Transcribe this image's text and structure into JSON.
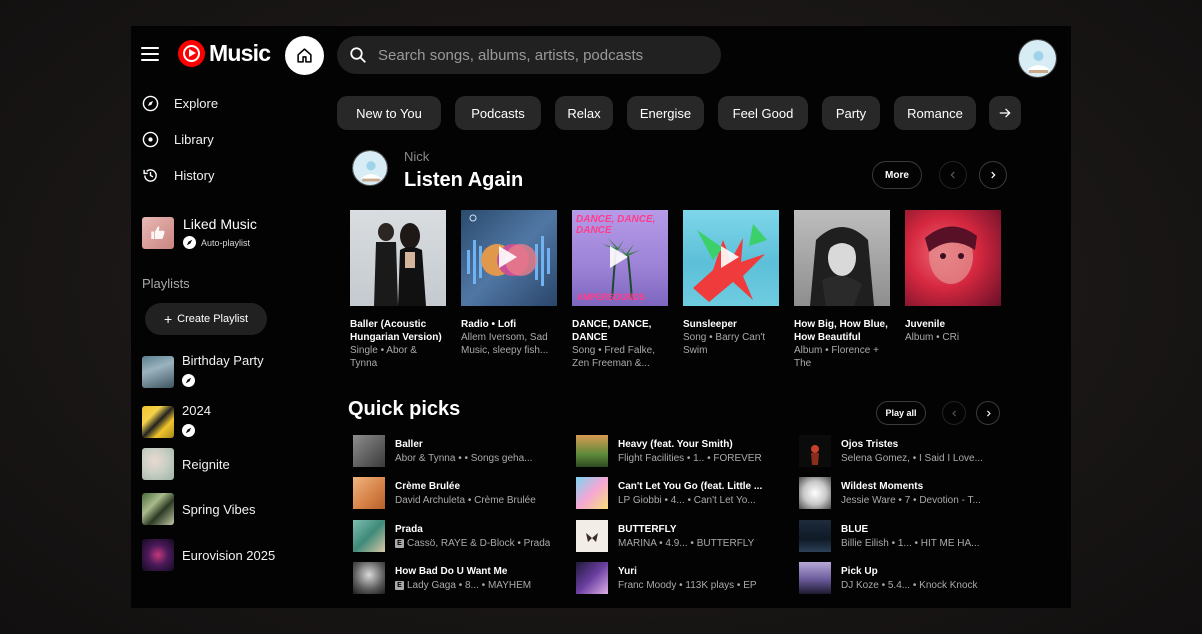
{
  "app": {
    "logo_text": "Music"
  },
  "search": {
    "placeholder": "Search songs, albums, artists, podcasts"
  },
  "nav": [
    {
      "label": "Explore",
      "icon": "compass-icon"
    },
    {
      "label": "Library",
      "icon": "library-icon"
    },
    {
      "label": "History",
      "icon": "history-icon"
    }
  ],
  "liked": {
    "title": "Liked Music",
    "subtitle": "Auto-playlist"
  },
  "playlists": {
    "heading": "Playlists",
    "create_label": "Create Playlist",
    "items": [
      {
        "title": "Birthday Party"
      },
      {
        "title": "2024"
      },
      {
        "title": "Reignite"
      },
      {
        "title": "Spring Vibes"
      },
      {
        "title": "Eurovision 2025"
      }
    ]
  },
  "chips": [
    "New to You",
    "Podcasts",
    "Relax",
    "Energise",
    "Feel Good",
    "Party",
    "Romance"
  ],
  "listen_again": {
    "user": "Nick",
    "title": "Listen Again",
    "more_label": "More",
    "cards": [
      {
        "title": "Baller (Acoustic Hungarian Version)",
        "subtitle": "Single • Abor & Tynna"
      },
      {
        "title": "Radio • Lofi",
        "subtitle": "Allem Iversom, Sad Music, sleepy fish..."
      },
      {
        "title": "DANCE, DANCE, DANCE",
        "subtitle": "Song • Fred Falke, Zen Freeman &..."
      },
      {
        "title": "Sunsleeper",
        "subtitle": "Song • Barry Can't Swim"
      },
      {
        "title": "How Big, How Blue, How Beautiful",
        "subtitle": "Album • Florence + The"
      },
      {
        "title": "Juvenile",
        "subtitle": "Album • CRi"
      }
    ],
    "art_text": {
      "dance": "DANCE, DANCE, DANCE",
      "ampersounds": "AMPERSOUNDS"
    }
  },
  "quick_picks": {
    "title": "Quick picks",
    "play_all_label": "Play all",
    "items": [
      {
        "title": "Baller",
        "subtitle": "Abor & Tynna • • Songs geha...",
        "explicit": false
      },
      {
        "title": "Crème Brulée",
        "subtitle": "David Archuleta • Crème Brulée",
        "explicit": false
      },
      {
        "title": "Prada",
        "subtitle": "Cassö, RAYE & D-Block • Prada",
        "explicit": true
      },
      {
        "title": "How Bad Do U Want Me",
        "subtitle": "Lady Gaga • 8... • MAYHEM",
        "explicit": true
      },
      {
        "title": "Heavy (feat. Your Smith)",
        "subtitle": "Flight Facilities • 1.. • FOREVER",
        "explicit": false
      },
      {
        "title": "Can't Let You Go (feat. Little ...",
        "subtitle": "LP Giobbi • 4... • Can't Let Yo...",
        "explicit": false
      },
      {
        "title": "BUTTERFLY",
        "subtitle": "MARINA • 4.9... • BUTTERFLY",
        "explicit": false
      },
      {
        "title": "Yuri",
        "subtitle": "Franc Moody • 113K plays • EP",
        "explicit": false
      },
      {
        "title": "Ojos Tristes",
        "subtitle": "Selena Gomez, • I Said I Love...",
        "explicit": false
      },
      {
        "title": "Wildest Moments",
        "subtitle": "Jessie Ware • 7 • Devotion - T...",
        "explicit": false
      },
      {
        "title": "BLUE",
        "subtitle": "Billie Eilish • 1... • HIT ME HA...",
        "explicit": false
      },
      {
        "title": "Pick Up",
        "subtitle": "DJ Koze • 5.4... • Knock Knock",
        "explicit": false
      }
    ]
  },
  "colors": {
    "brand": "#ff0000",
    "background": "#030303",
    "chip": "#282828",
    "search": "#212121"
  }
}
